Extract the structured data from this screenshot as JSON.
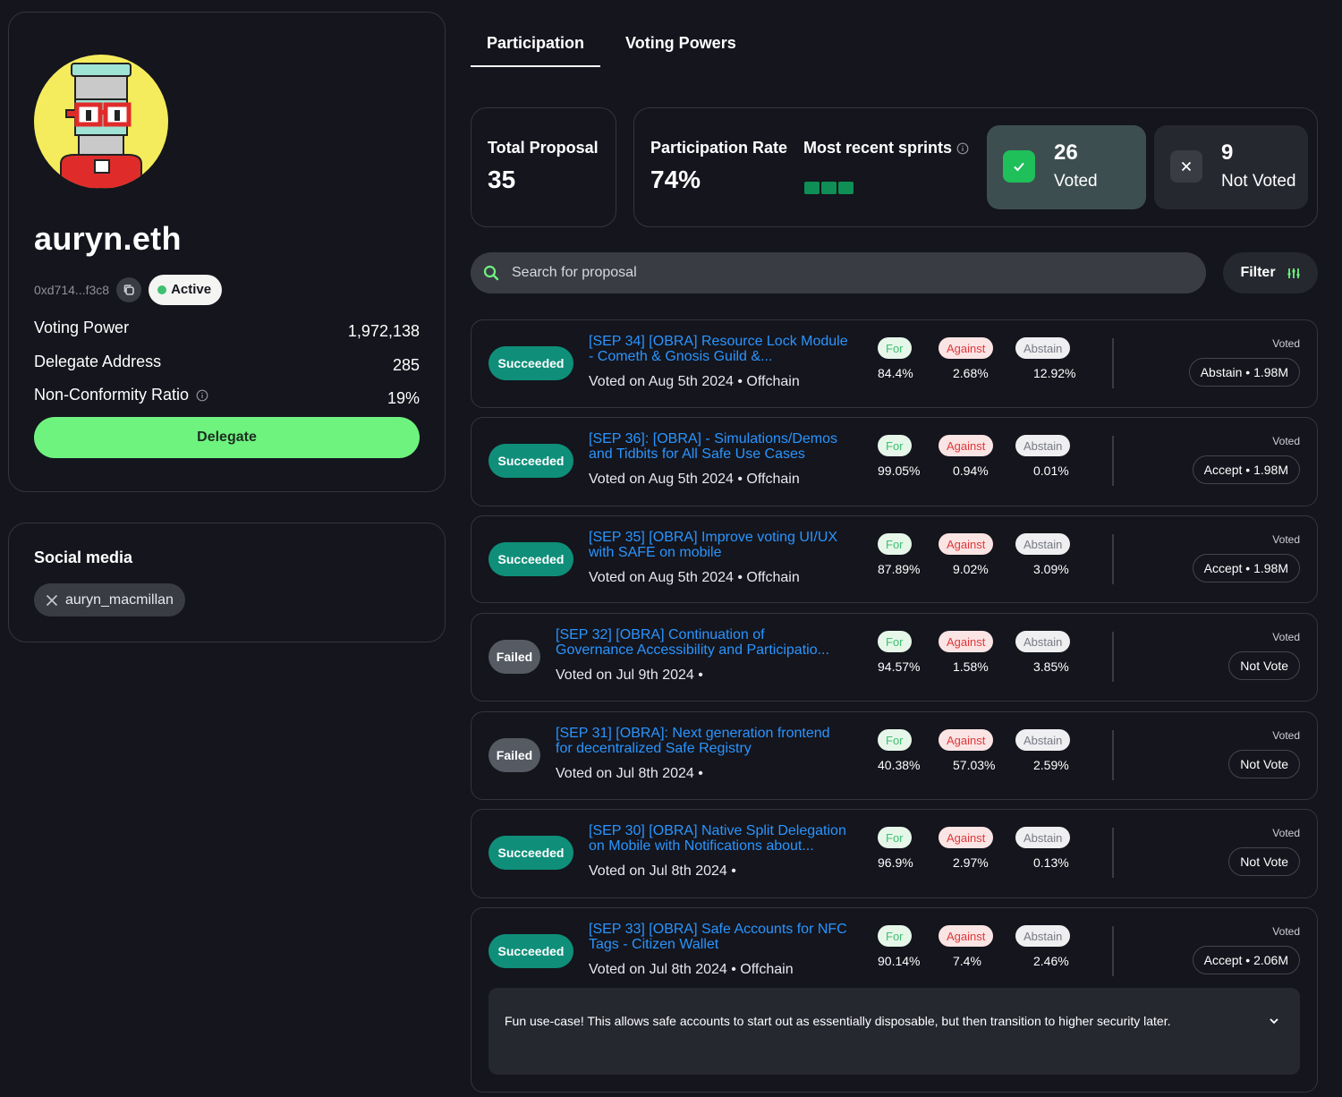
{
  "profile": {
    "username": "auryn.eth",
    "address": "0xd714...f3c8",
    "status": "Active",
    "stats": [
      {
        "label": "Voting Power",
        "value": "1,972,138",
        "info": false
      },
      {
        "label": "Delegate Address",
        "value": "285",
        "info": false
      },
      {
        "label": "Non-Conformity Ratio",
        "value": "19%",
        "info": true
      }
    ],
    "delegate_label": "Delegate"
  },
  "social": {
    "title": "Social media",
    "handle": "auryn_macmillan",
    "platform_icon": "x-logo-icon"
  },
  "tabs": [
    {
      "label": "Participation",
      "active": true
    },
    {
      "label": "Voting Powers",
      "active": false
    }
  ],
  "summary": {
    "total_label": "Total Proposal",
    "total_value": "35",
    "rate_label": "Participation Rate",
    "rate_value": "74%",
    "sprints_label": "Most recent sprints",
    "sprints_count": 3,
    "voted_count": "26",
    "voted_label": "Voted",
    "not_voted_count": "9",
    "not_voted_label": "Not Voted",
    "voted_color": "#1fbf5a",
    "not_voted_color": "#3a3c44"
  },
  "search": {
    "placeholder": "Search for proposal",
    "filter_label": "Filter"
  },
  "proposals": [
    {
      "status": "Succeeded",
      "title": "[SEP 34] [OBRA] Resource Lock Module\n- Cometh & Gnosis Guild &...",
      "meta": "Voted on Aug 5th 2024 • Offchain",
      "for_label": "For",
      "for": "84.4%",
      "against_label": "Against",
      "against": "2.68%",
      "abstain_label": "Abstain",
      "abstain": "12.92%",
      "voted_label": "Voted",
      "vote": "Abstain • 1.98M"
    },
    {
      "status": "Succeeded",
      "title": "[SEP 36]: [OBRA] - Simulations/Demos\nand Tidbits for All Safe Use Cases",
      "meta": "Voted on Aug 5th 2024 • Offchain",
      "for_label": "For",
      "for": "99.05%",
      "against_label": "Against",
      "against": "0.94%",
      "abstain_label": "Abstain",
      "abstain": "0.01%",
      "voted_label": "Voted",
      "vote": "Accept • 1.98M"
    },
    {
      "status": "Succeeded",
      "title": "[SEP 35] [OBRA] Improve voting UI/UX\nwith SAFE on mobile",
      "meta": "Voted on Aug 5th 2024 • Offchain",
      "for_label": "For",
      "for": "87.89%",
      "against_label": "Against",
      "against": "9.02%",
      "abstain_label": "Abstain",
      "abstain": "3.09%",
      "voted_label": "Voted",
      "vote": "Accept • 1.98M"
    },
    {
      "status": "Failed",
      "title": "[SEP 32] [OBRA] Continuation of\nGovernance Accessibility and Participatio...",
      "meta": "Voted on Jul 9th 2024 •",
      "for_label": "For",
      "for": "94.57%",
      "against_label": "Against",
      "against": "1.58%",
      "abstain_label": "Abstain",
      "abstain": "3.85%",
      "voted_label": "Voted",
      "vote": "Not Vote"
    },
    {
      "status": "Failed",
      "title": "[SEP 31] [OBRA]: Next generation frontend\nfor decentralized Safe Registry",
      "meta": "Voted on Jul 8th 2024 •",
      "for_label": "For",
      "for": "40.38%",
      "against_label": "Against",
      "against": "57.03%",
      "abstain_label": "Abstain",
      "abstain": "2.59%",
      "voted_label": "Voted",
      "vote": "Not Vote"
    },
    {
      "status": "Succeeded",
      "title": "[SEP 30] [OBRA] Native Split Delegation\non Mobile with Notifications about...",
      "meta": "Voted on Jul 8th 2024 •",
      "for_label": "For",
      "for": "96.9%",
      "against_label": "Against",
      "against": "2.97%",
      "abstain_label": "Abstain",
      "abstain": "0.13%",
      "voted_label": "Voted",
      "vote": "Not Vote"
    },
    {
      "status": "Succeeded",
      "title": "[SEP 33] [OBRA] Safe Accounts for NFC\nTags - Citizen Wallet",
      "meta": "Voted on Jul 8th 2024 • Offchain",
      "for_label": "For",
      "for": "90.14%",
      "against_label": "Against",
      "against": "7.4%",
      "abstain_label": "Abstain",
      "abstain": "2.46%",
      "voted_label": "Voted",
      "vote": "Accept • 2.06M",
      "comment": "Fun use-case! This allows safe accounts to start out as essentially disposable, but then transition to higher security later."
    }
  ]
}
